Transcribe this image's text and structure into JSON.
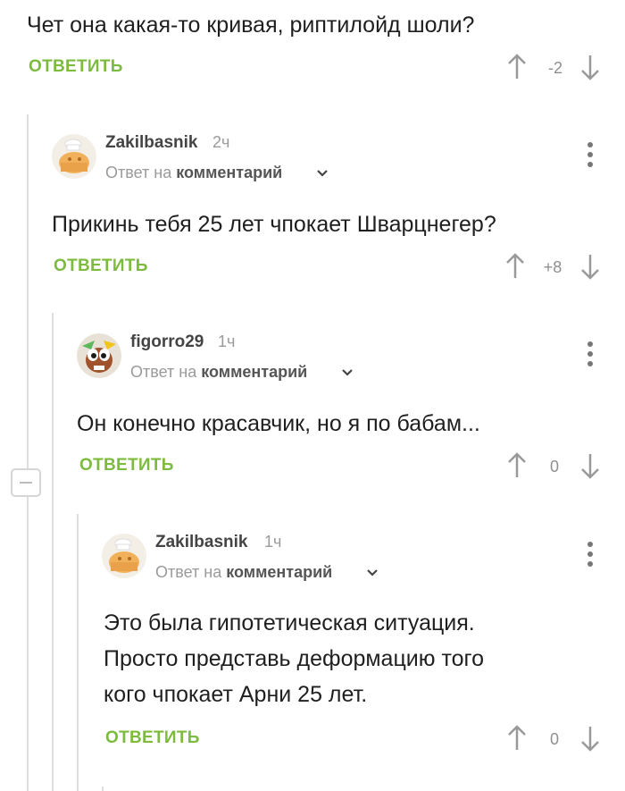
{
  "comments": [
    {
      "text": "Чет она какая-то кривая, риптилойд шоли?",
      "reply": "ОТВЕТИТЬ",
      "rating": "-2"
    },
    {
      "author": "Zakilbasnik",
      "time": "2ч",
      "reply_to_prefix": "Ответ на",
      "reply_to_link": "комментарий",
      "text": "Прикинь тебя 25 лет чпокает Шварцнегер?",
      "reply": "ОТВЕТИТЬ",
      "rating": "+8"
    },
    {
      "author": "figorro29",
      "time": "1ч",
      "reply_to_prefix": "Ответ на",
      "reply_to_link": "комментарий",
      "text": "Он конечно красавчик, но я по бабам...",
      "reply": "ОТВЕТИТЬ",
      "rating": "0"
    },
    {
      "author": "Zakilbasnik",
      "time": "1ч",
      "reply_to_prefix": "Ответ на",
      "reply_to_link": "комментарий",
      "text_lines": [
        "Это была гипотетическая ситуация.",
        "Просто представь деформацию того",
        "кого чпокает Арни 25 лет."
      ],
      "reply": "ОТВЕТИТЬ",
      "rating": "0"
    }
  ],
  "icons": {
    "upvote": "arrow-up-icon",
    "downvote": "arrow-down-icon",
    "more": "more-vertical-icon",
    "collapse": "collapse-minus-icon",
    "chevron": "chevron-down-icon"
  },
  "colors": {
    "reply": "#7dbb3f",
    "thread_line": "#dedede",
    "meta": "#9a9a9a"
  }
}
